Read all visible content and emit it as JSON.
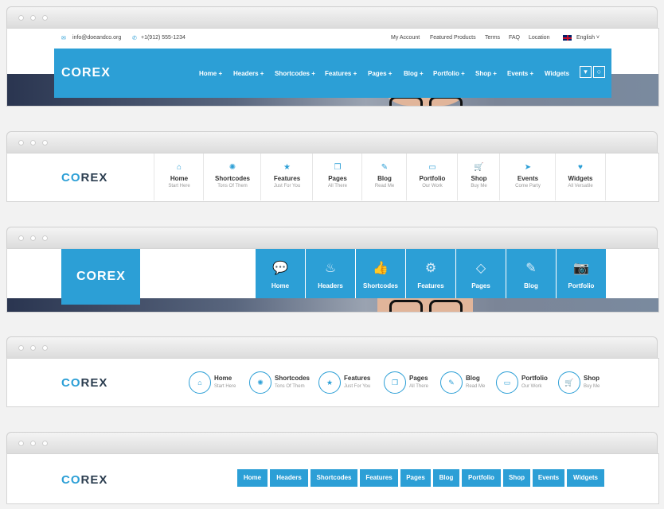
{
  "brand": {
    "logo_accent": "CO",
    "logo_rest": "REX",
    "accent_color": "#2c9fd6"
  },
  "layout1": {
    "email": "info@doeandco.org",
    "phone": "+1(912) 555-1234",
    "links": [
      "My Account",
      "Featured Products",
      "Terms",
      "FAQ",
      "Location"
    ],
    "language": "English",
    "nav": [
      "Home +",
      "Headers +",
      "Shortcodes +",
      "Features +",
      "Pages +",
      "Blog +",
      "Portfolio +",
      "Shop +",
      "Events +",
      "Widgets"
    ],
    "icons": [
      "cart-icon",
      "search-icon"
    ]
  },
  "layout2": {
    "items": [
      {
        "icon": "home-icon",
        "glyph": "⌂",
        "title": "Home",
        "sub": "Start Here"
      },
      {
        "icon": "gear-icon",
        "glyph": "✺",
        "title": "Shortcodes",
        "sub": "Tons Of Them"
      },
      {
        "icon": "star-icon",
        "glyph": "★",
        "title": "Features",
        "sub": "Just For You"
      },
      {
        "icon": "copy-icon",
        "glyph": "❐",
        "title": "Pages",
        "sub": "All There"
      },
      {
        "icon": "pencil-icon",
        "glyph": "✎",
        "title": "Blog",
        "sub": "Read Me"
      },
      {
        "icon": "card-icon",
        "glyph": "▭",
        "title": "Portfolio",
        "sub": "Our Work"
      },
      {
        "icon": "cart-icon",
        "glyph": "🛒",
        "title": "Shop",
        "sub": "Buy Me"
      },
      {
        "icon": "location-arrow-icon",
        "glyph": "➤",
        "title": "Events",
        "sub": "Come Party"
      },
      {
        "icon": "heart-icon",
        "glyph": "♥",
        "title": "Widgets",
        "sub": "All Versatile"
      }
    ]
  },
  "layout3": {
    "items": [
      {
        "icon": "speech-bubble-icon",
        "glyph": "💬",
        "title": "Home"
      },
      {
        "icon": "flame-icon",
        "glyph": "♨",
        "title": "Headers"
      },
      {
        "icon": "thumbs-up-icon",
        "glyph": "👍",
        "title": "Shortcodes"
      },
      {
        "icon": "gear-icon",
        "glyph": "⚙",
        "title": "Features"
      },
      {
        "icon": "diamond-icon",
        "glyph": "◇",
        "title": "Pages"
      },
      {
        "icon": "pencil-icon",
        "glyph": "✎",
        "title": "Blog"
      },
      {
        "icon": "camera-icon",
        "glyph": "📷",
        "title": "Portfolio"
      }
    ]
  },
  "layout4": {
    "items": [
      {
        "icon": "home-icon",
        "glyph": "⌂",
        "title": "Home",
        "sub": "Start Here"
      },
      {
        "icon": "gear-icon",
        "glyph": "✺",
        "title": "Shortcodes",
        "sub": "Tons Of Them"
      },
      {
        "icon": "star-icon",
        "glyph": "★",
        "title": "Features",
        "sub": "Just For You"
      },
      {
        "icon": "copy-icon",
        "glyph": "❐",
        "title": "Pages",
        "sub": "All There"
      },
      {
        "icon": "pencil-icon",
        "glyph": "✎",
        "title": "Blog",
        "sub": "Read Me"
      },
      {
        "icon": "card-icon",
        "glyph": "▭",
        "title": "Portfolio",
        "sub": "Our Work"
      },
      {
        "icon": "cart-icon",
        "glyph": "🛒",
        "title": "Shop",
        "sub": "Buy Me"
      }
    ]
  },
  "layout5": {
    "items": [
      "Home",
      "Headers",
      "Shortcodes",
      "Features",
      "Pages",
      "Blog",
      "Portfolio",
      "Shop",
      "Events",
      "Widgets"
    ]
  }
}
